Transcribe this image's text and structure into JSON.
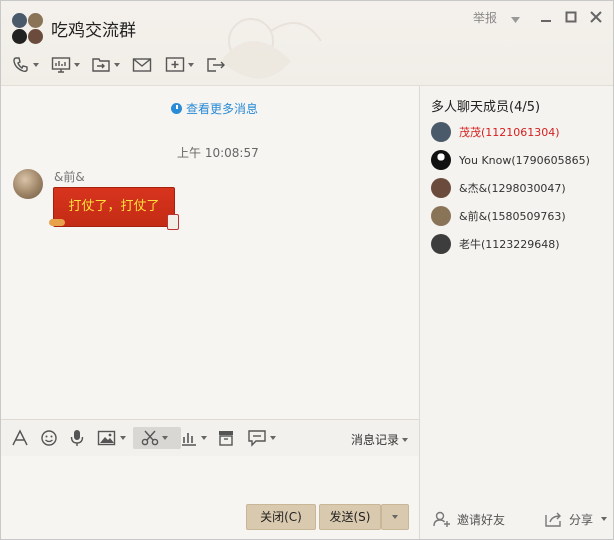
{
  "window": {
    "title": "吃鸡交流群",
    "report_label": "举报",
    "controls": {
      "minimize": "minimize-icon",
      "maximize": "maximize-icon",
      "close": "close-icon"
    }
  },
  "toolbar": {
    "icons": [
      "phone-icon",
      "screen-share-icon",
      "file-transfer-icon",
      "mail-icon",
      "add-app-icon",
      "exit-share-icon"
    ]
  },
  "chat": {
    "view_more": "查看更多消息",
    "timestamp": "上午 10:08:57",
    "messages": [
      {
        "sender": "&前&",
        "text": "打仗了，打仗了"
      }
    ]
  },
  "input_toolbar": {
    "icons": [
      "font-icon",
      "emoji-icon",
      "voice-icon",
      "image-icon",
      "scissors-icon",
      "chart-icon",
      "archive-icon",
      "comment-icon"
    ],
    "history_label": "消息记录"
  },
  "buttons": {
    "close_label": "关闭(C)",
    "send_label": "发送(S)"
  },
  "members": {
    "title": "多人聊天成员(4/5)",
    "list": [
      {
        "name": "茂茂(1121061304)",
        "owner": true,
        "color": "#4a5a6a"
      },
      {
        "name": "You Know(1790605865)",
        "owner": false,
        "color": "#111111"
      },
      {
        "name": "&杰&(1298030047)",
        "owner": false,
        "color": "#6b4c3c"
      },
      {
        "name": "&前&(1580509763)",
        "owner": false,
        "color": "#8a7458"
      },
      {
        "name": "老牛(1123229648)",
        "owner": false,
        "color": "#3d3d3d"
      }
    ],
    "invite_label": "邀请好友",
    "share_label": "分享"
  },
  "colors": {
    "accent_link": "#2a8bd6",
    "owner_red": "#d42020",
    "bubble_red": "#c32b14",
    "bubble_text": "#ffe03a",
    "button_tan": "#d9c9ae"
  }
}
